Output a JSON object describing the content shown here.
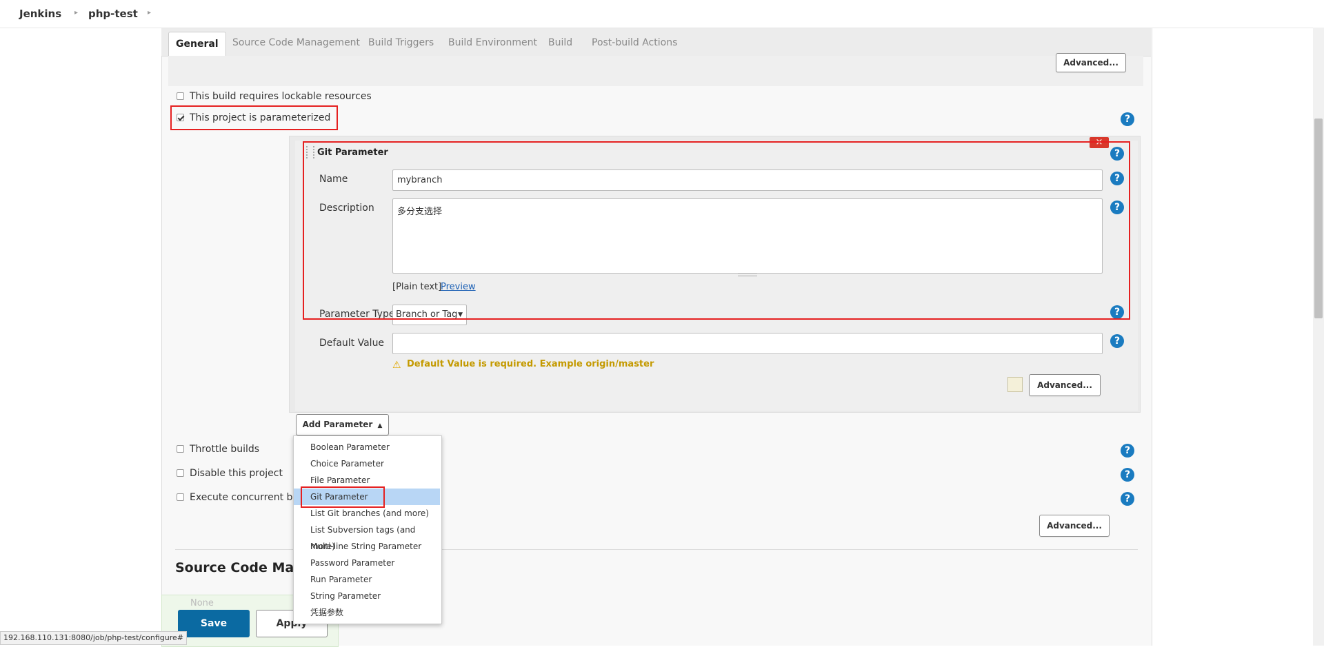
{
  "breadcrumb": {
    "home": "Jenkins",
    "job": "php-test"
  },
  "tabs": [
    "General",
    "Source Code Management",
    "Build Triggers",
    "Build Environment",
    "Build",
    "Post-build Actions"
  ],
  "advanced_label": "Advanced...",
  "options": {
    "lockable": {
      "label": "This build requires lockable resources",
      "checked": false
    },
    "parameterized": {
      "label": "This project is parameterized",
      "checked": true
    },
    "throttle": {
      "label": "Throttle builds",
      "checked": false
    },
    "disable": {
      "label": "Disable this project",
      "checked": false
    },
    "concurrent": {
      "label": "Execute concurrent builds",
      "checked": false
    }
  },
  "git_param": {
    "title": "Git Parameter",
    "delete_glyph": "×",
    "name_label": "Name",
    "name_value": "mybranch",
    "description_label": "Description",
    "description_value": "多分支选择",
    "plain_text": "[Plain text]",
    "preview": "Preview",
    "type_label": "Parameter Type",
    "type_value": "Branch or Tag",
    "default_label": "Default Value",
    "default_value": "",
    "warning": "Default Value is required. Example origin/master"
  },
  "add_parameter": {
    "label": "Add Parameter"
  },
  "menu_items": [
    "Boolean Parameter",
    "Choice Parameter",
    "File Parameter",
    "Git Parameter",
    "List Git branches (and more)",
    "List Subversion tags (and more)",
    "Multi-line String Parameter",
    "Password Parameter",
    "Run Parameter",
    "String Parameter",
    "凭据参数"
  ],
  "menu_highlighted": "Git Parameter",
  "section_heading": "Source Code Mana",
  "scm_none": "None",
  "buttons": {
    "save": "Save",
    "apply": "Apply"
  },
  "status_url": "192.168.110.131:8080/job/php-test/configure#",
  "colors": {
    "accent_blue": "#1a7bc0",
    "save_blue": "#0b6aa2",
    "highlight_red": "#e52020",
    "warning": "#c49a00"
  }
}
